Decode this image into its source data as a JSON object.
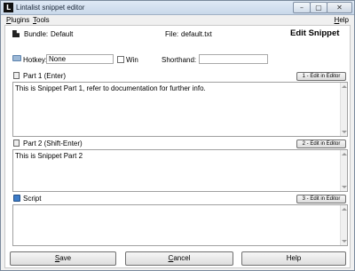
{
  "window": {
    "title": "Lintalist snippet editor",
    "icon_letter": "L",
    "controls": {
      "minimize": "–",
      "maximize": "▢",
      "close": "✕"
    }
  },
  "menu": {
    "plugins": {
      "mnemonic": "P",
      "rest": "lugins"
    },
    "tools": {
      "mnemonic": "T",
      "rest": "ools"
    },
    "help": {
      "mnemonic": "H",
      "rest": "elp"
    }
  },
  "header": {
    "bundle_label": "Bundle:",
    "bundle_value": "Default",
    "file_label": "File:",
    "file_value": "default.txt",
    "page_title": "Edit Snippet"
  },
  "hotkey": {
    "label": "Hotkey:",
    "value": "None",
    "win_label": "Win",
    "win_checked": false,
    "shorthand_label": "Shorthand:",
    "shorthand_value": ""
  },
  "parts": [
    {
      "label": "Part 1 (Enter)",
      "button": "1 - Edit in Editor",
      "text": "This is Snippet Part 1, refer to documentation for further info."
    },
    {
      "label": "Part 2 (Shift-Enter)",
      "button": "2 - Edit in Editor",
      "text": "This is Snippet Part 2"
    },
    {
      "label": "Script",
      "button": "3 - Edit in Editor",
      "text": ""
    }
  ],
  "footer": {
    "save": {
      "mnemonic": "S",
      "rest": "ave"
    },
    "cancel": {
      "mnemonic": "C",
      "rest": "ancel"
    },
    "help": "Help"
  },
  "icons": [
    "app-icon",
    "bundle-icon",
    "folder-icon",
    "document-icon",
    "script-icon"
  ]
}
